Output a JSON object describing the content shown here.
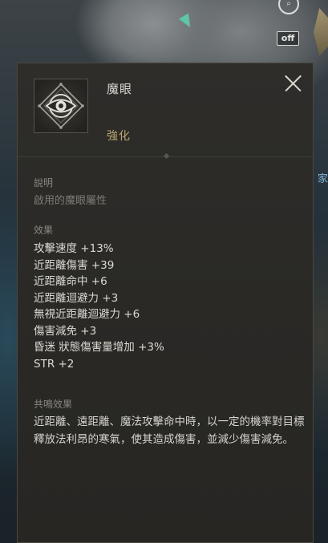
{
  "scene": {
    "search_button_icon": "search-icon",
    "toggle_button_label": "off",
    "side_label": "家"
  },
  "tooltip": {
    "item_name": "魔眼",
    "item_type": "強化",
    "item_icon": "eye-emblem-icon",
    "close_icon": "close-icon",
    "description_title": "說明",
    "description_text": "啟用的魔眼屬性",
    "effects_title": "效果",
    "effects": [
      "攻擊速度 +13%",
      "近距離傷害 +39",
      "近距離命中 +6",
      "近距離迴避力 +3",
      "無視近距離迴避力 +6",
      "傷害減免 +3",
      "昏迷 狀態傷害量增加 +3%",
      "STR +2"
    ],
    "resonance_title": "共鳴效果",
    "resonance_text": "近距離、遠距離、魔法攻擊命中時，以一定的機率對目標釋放法利昂的寒氣，使其造成傷害，並減少傷害減免。"
  },
  "colors": {
    "panel_bg": "#2b2a27",
    "item_type_gold": "#b7a56f",
    "text_primary": "#dcdad3",
    "text_muted": "#8a877f",
    "map_marker": "#5ec6a8"
  }
}
